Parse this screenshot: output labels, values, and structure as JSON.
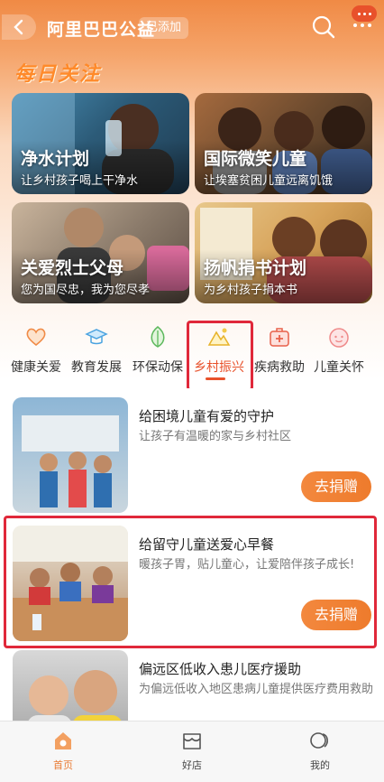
{
  "header": {
    "title": "阿里巴巴公益",
    "added_badge": "已添加"
  },
  "section": {
    "daily_title": "每日关注"
  },
  "features": [
    {
      "title": "净水计划",
      "subtitle": "让乡村孩子喝上干净水"
    },
    {
      "title": "国际微笑儿童",
      "subtitle": "让埃塞贫困儿童远离饥饿"
    },
    {
      "title": "关爱烈士父母",
      "subtitle": "您为国尽忠，我为您尽孝"
    },
    {
      "title": "扬帆捐书计划",
      "subtitle": "为乡村孩子捐本书"
    }
  ],
  "categories": [
    {
      "label": "健康关爱",
      "icon": "heart-icon"
    },
    {
      "label": "教育发展",
      "icon": "graduation-cap-icon"
    },
    {
      "label": "环保动保",
      "icon": "leaf-icon"
    },
    {
      "label": "乡村振兴",
      "icon": "mountain-icon",
      "active": true
    },
    {
      "label": "疾病救助",
      "icon": "medical-kit-icon"
    },
    {
      "label": "儿童关怀",
      "icon": "child-face-icon"
    }
  ],
  "projects": [
    {
      "title": "给困境儿童有爱的守护",
      "subtitle": "让孩子有温暖的家与乡村社区",
      "button": "去捐赠"
    },
    {
      "title": "给留守儿童送爱心早餐",
      "subtitle": "暖孩子胃，贴儿童心，让爱陪伴孩子成长!",
      "button": "去捐赠"
    },
    {
      "title": "偏远区低收入患儿医疗援助",
      "subtitle": "为偏远低收入地区患病儿童提供医疗费用救助",
      "button": ""
    }
  ],
  "bottom_nav": [
    {
      "label": "首页",
      "icon": "home-icon",
      "active": true
    },
    {
      "label": "好店",
      "icon": "shop-icon"
    },
    {
      "label": "我的",
      "icon": "profile-icon"
    }
  ],
  "colors": {
    "accent": "#ee7b2c",
    "highlight_box": "#e0283a",
    "active_text": "#e8512b"
  }
}
